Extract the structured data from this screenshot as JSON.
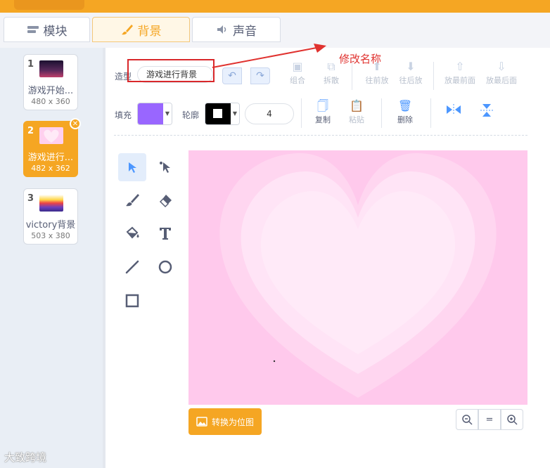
{
  "tabs": [
    {
      "label": "模块",
      "icon": "blocks-icon"
    },
    {
      "label": "背景",
      "icon": "brush-icon",
      "active": true
    },
    {
      "label": "声音",
      "icon": "speaker-icon"
    }
  ],
  "backdrops": [
    {
      "index": "1",
      "name": "游戏开始...",
      "size": "480 x 360"
    },
    {
      "index": "2",
      "name": "游戏进行...",
      "size": "482 x 362",
      "selected": true
    },
    {
      "index": "3",
      "name": "victory背景",
      "size": "503 x 380"
    }
  ],
  "toolbar": {
    "costume_label": "造型",
    "costume_name": "游戏进行背景",
    "group": "组合",
    "ungroup": "拆散",
    "forward": "往前放",
    "backward": "往后放",
    "front": "放最前面",
    "back": "放最后面",
    "fill_label": "填充",
    "outline_label": "轮廓",
    "outline_width": "4",
    "copy": "复制",
    "paste": "粘贴",
    "delete": "删除"
  },
  "annotation": "修改名称",
  "convert_button": "转换为位图",
  "watermark": "大致跨境",
  "colors": {
    "accent": "#f5a623",
    "fill": "#9966ff",
    "outline": "#000000",
    "canvas_bg": "#ffc9ec",
    "annotation": "#e0322f"
  }
}
